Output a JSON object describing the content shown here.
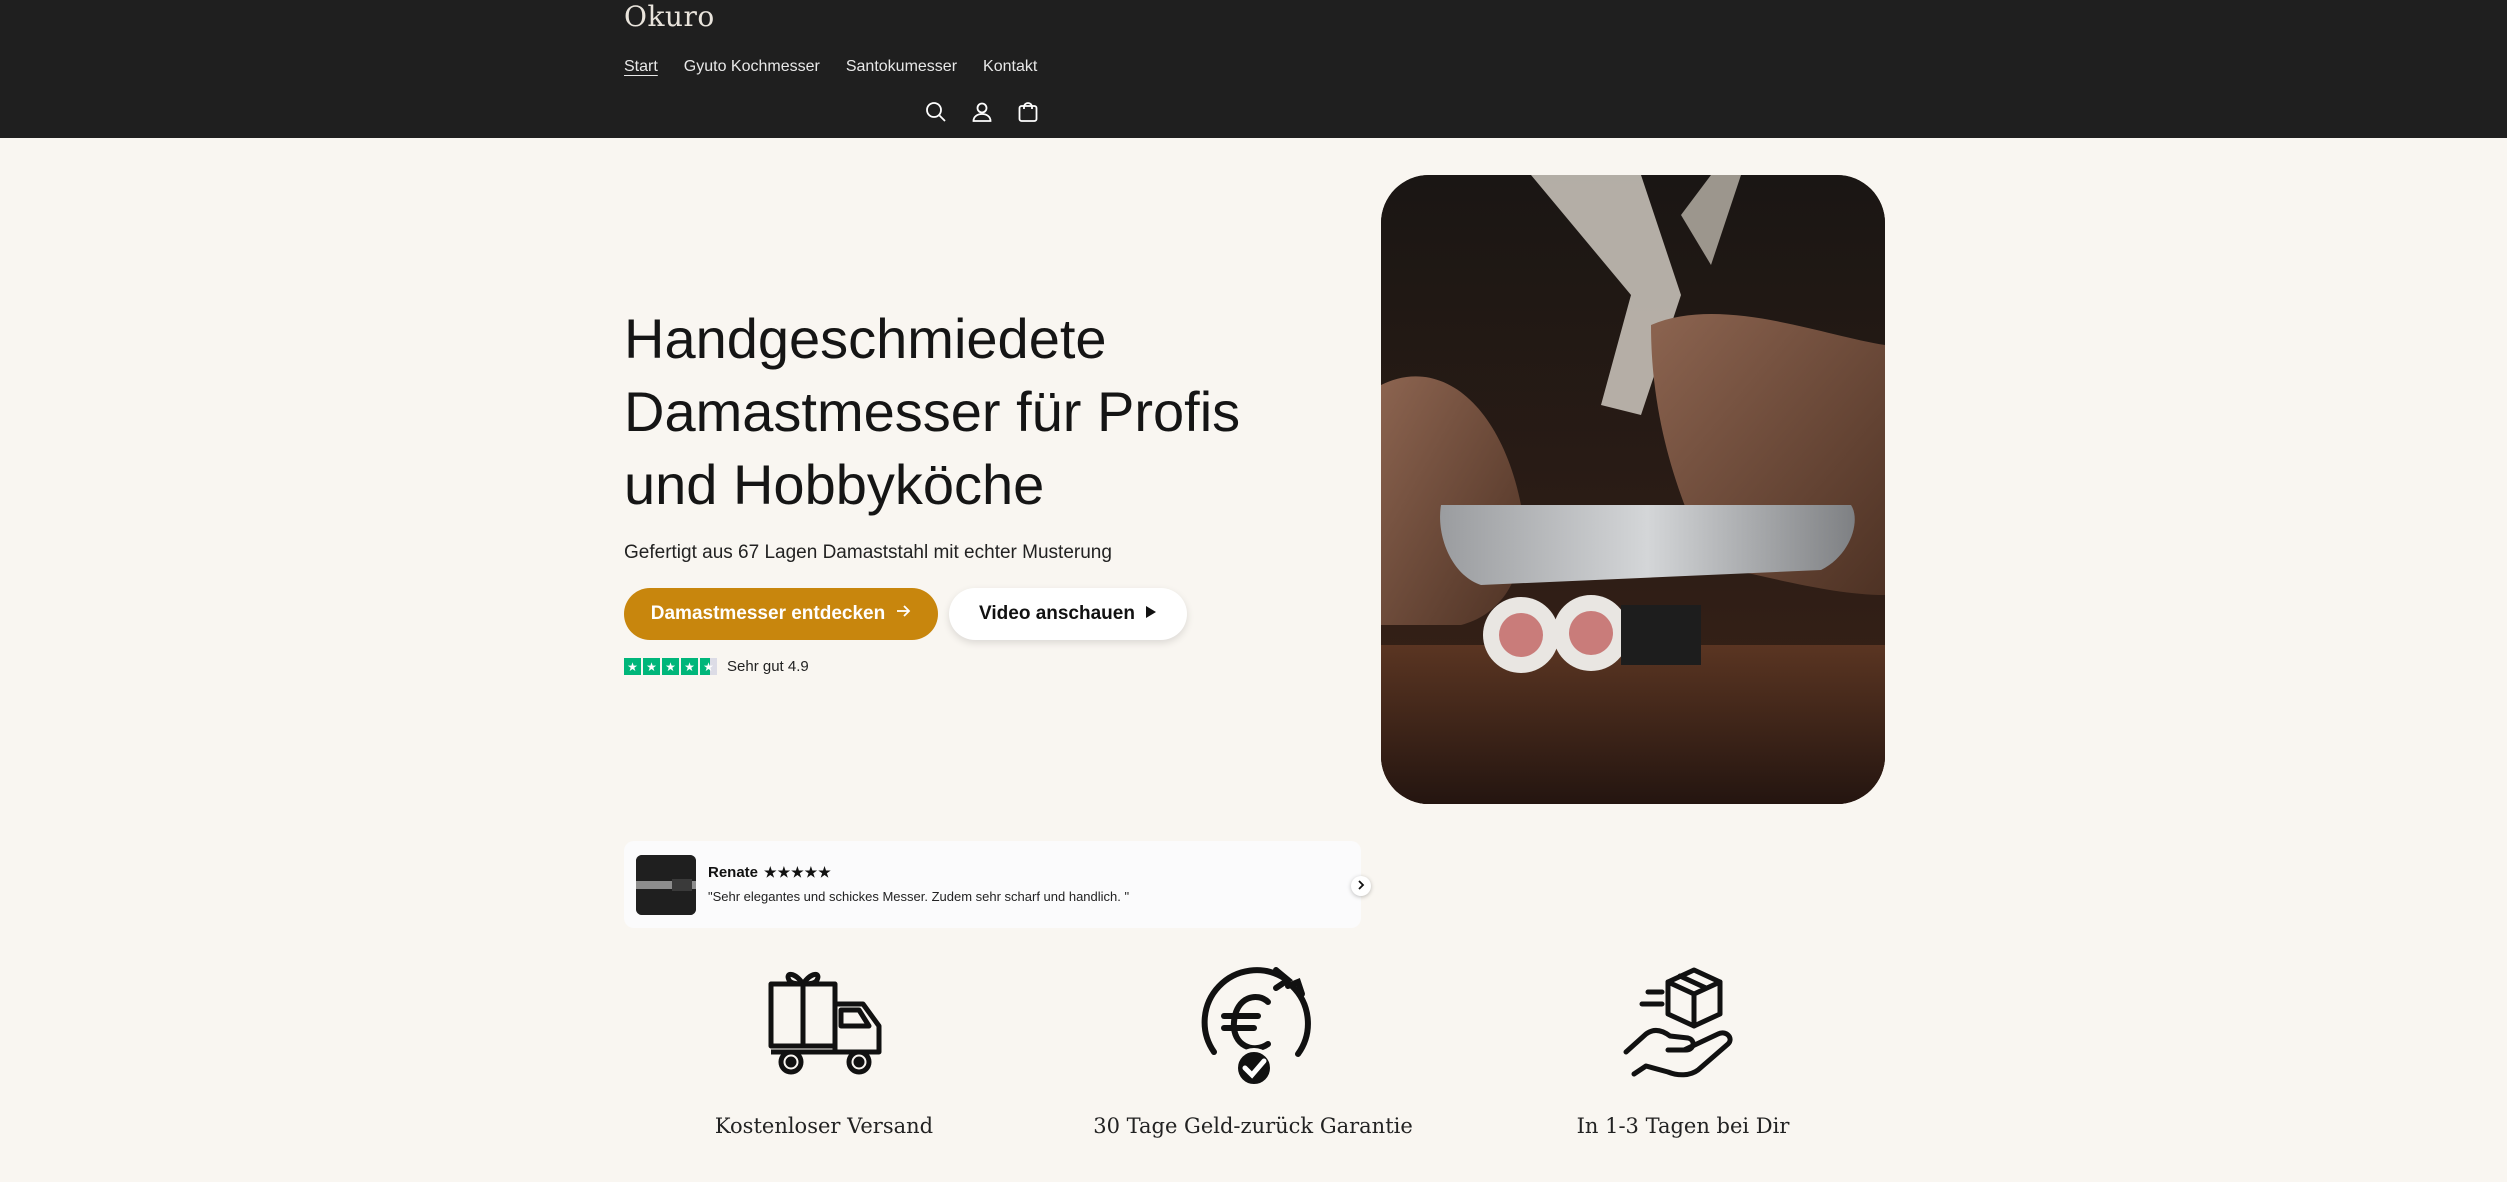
{
  "header": {
    "logo": "Okuro",
    "nav": [
      {
        "label": "Start",
        "active": true
      },
      {
        "label": "Gyuto Kochmesser",
        "active": false
      },
      {
        "label": "Santokumesser",
        "active": false
      },
      {
        "label": "Kontakt",
        "active": false
      }
    ],
    "icons": [
      "search-icon",
      "account-icon",
      "cart-icon"
    ]
  },
  "hero": {
    "title": "Handgeschmiedete Damastmesser für Profis und Hobbyköche",
    "subtitle": "Gefertigt aus 67 Lagen Damaststahl mit echter Musterung",
    "primary_button": "Damastmesser entdecken",
    "secondary_button": "Video anschauen",
    "rating_text": "Sehr gut 4.9",
    "rating_value": 4.5,
    "accent_color": "#c8860d",
    "rating_color": "#00b67a"
  },
  "review": {
    "name": "Renate",
    "stars": "★★★★★",
    "text": "\"Sehr elegantes und schickes Messer. Zudem sehr scharf und handlich. \""
  },
  "features": [
    {
      "icon": "delivery-truck-icon",
      "label": "Kostenloser Versand"
    },
    {
      "icon": "euro-guarantee-icon",
      "label": "30 Tage Geld-zurück Garantie"
    },
    {
      "icon": "package-hand-icon",
      "label": "In 1-3 Tagen bei Dir"
    }
  ]
}
